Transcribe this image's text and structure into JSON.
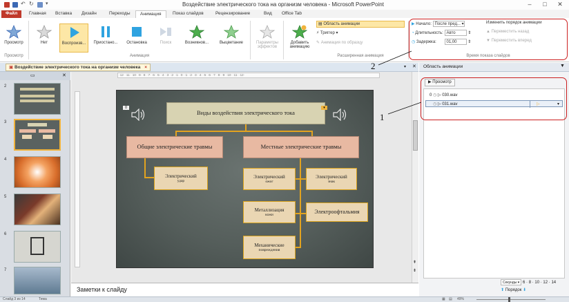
{
  "window": {
    "title": "Воздействие электрического тока на организм человека - Microsoft PowerPoint",
    "controls": {
      "minimize": "–",
      "maximize": "□",
      "close": "✕"
    }
  },
  "ribbon_tabs": [
    {
      "label": "Файл"
    },
    {
      "label": "Главная"
    },
    {
      "label": "Вставка"
    },
    {
      "label": "Дизайн"
    },
    {
      "label": "Переходы"
    },
    {
      "label": "Анимация"
    },
    {
      "label": "Показ слайдов"
    },
    {
      "label": "Рецензирование"
    },
    {
      "label": "Вид"
    },
    {
      "label": "Office Tab"
    }
  ],
  "ribbon": {
    "preview": {
      "label": "Просмотр",
      "group": "Просмотр"
    },
    "anim_group_label": "Анимация",
    "effects": [
      {
        "label": "Нет"
      },
      {
        "label": "Воспроизв..."
      },
      {
        "label": "Приостано..."
      },
      {
        "label": "Остановка"
      },
      {
        "label": "Поиск"
      },
      {
        "label": "Возникнов..."
      },
      {
        "label": "Выцветание"
      }
    ],
    "effect_params": {
      "line1": "Параметры",
      "line2": "эффектов"
    },
    "add_animation": {
      "line1": "Добавить",
      "line2": "анимацию"
    },
    "advanced": {
      "group": "Расширенная анимация",
      "pane": "Область анимации",
      "trigger": "Триггер",
      "painter": "Анимация по образцу"
    },
    "timing": {
      "group": "Время показа слайдов",
      "start_label": "Начало:",
      "start_value": "После пред...",
      "duration_label": "Длительность:",
      "duration_value": "Авто",
      "delay_label": "Задержка:",
      "delay_value": "01,00",
      "reorder": "Изменить порядок анимации",
      "move_earlier": "Переместить назад",
      "move_later": "Переместить вперед"
    }
  },
  "document_tab": {
    "label": "Воздействие электрического тока на организм человека",
    "close": "×"
  },
  "anim_pane": {
    "title": "Область анимации",
    "play_label": "Просмотр",
    "items": [
      {
        "num": "0",
        "name": "030.wav"
      },
      {
        "num": "",
        "name": "031.wav"
      }
    ],
    "seconds_label": "Секунды",
    "scale": [
      "6",
      "8",
      "10",
      "12",
      "14"
    ],
    "order_label": "Порядок"
  },
  "slide": {
    "title": "Виды воздействия электрического тока",
    "left_category": "Общие электрические травмы",
    "right_category": "Местные электрические травмы",
    "left_items": [
      {
        "line1": "Электрический",
        "line2": "удар"
      }
    ],
    "right_col1": [
      {
        "line1": "Электрический",
        "line2": "ожог"
      },
      {
        "line1": "Металлизация",
        "line2": "кожи"
      },
      {
        "line1": "Механические",
        "line2": "повреждения"
      }
    ],
    "right_col2": [
      {
        "line1": "Электрический",
        "line2": "знак"
      },
      {
        "line1": "Электроофтальмия",
        "line2": ""
      }
    ]
  },
  "slide_numbers": [
    "2",
    "3",
    "4",
    "5",
    "6",
    "7"
  ],
  "notes_placeholder": "Заметки к слайду",
  "status": {
    "left": "Слайд 3 из 14",
    "theme": "Тема",
    "zoom": "49%"
  },
  "callouts": {
    "one": "1",
    "two": "2"
  },
  "colors": {
    "accent_red": "#cc1f1f",
    "connector": "#e3a31f",
    "selected": "#f0b33c"
  }
}
